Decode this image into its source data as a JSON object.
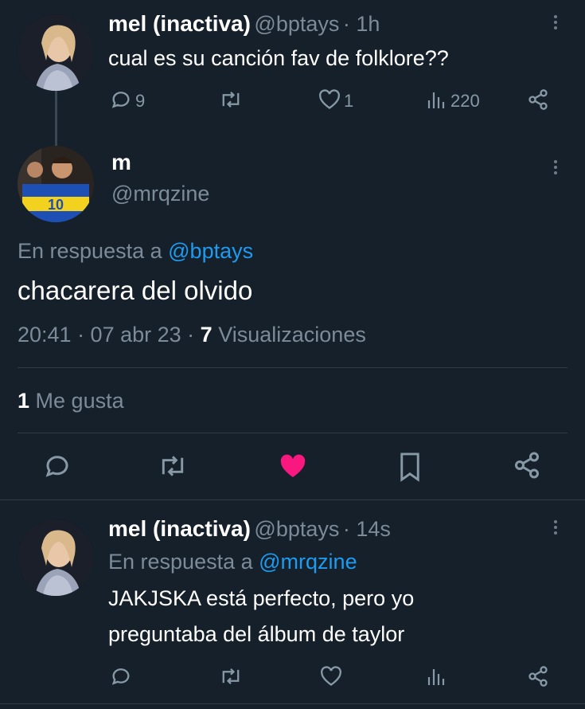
{
  "tweet1": {
    "name": "mel (inactiva)",
    "handle": "@bptays",
    "time": "· 1h",
    "text": "cual es su canción fav de folklore??",
    "replies": "9",
    "likes": "1",
    "views": "220"
  },
  "tweet2": {
    "name": "m",
    "handle": "@mrqzine",
    "reply_prefix": "En respuesta a",
    "reply_to": "@bptays",
    "text": "chacarera del olvido",
    "timestamp": "20:41 · 07 abr 23 ·",
    "view_count": "7",
    "view_label": "Visualizaciones",
    "like_count": "1",
    "like_label": "Me gusta"
  },
  "tweet3": {
    "name": "mel (inactiva)",
    "handle": "@bptays",
    "time": "· 14s",
    "reply_prefix": "En respuesta a",
    "reply_to": "@mrqzine",
    "text_line1": "JAKJSKA está perfecto, pero yo",
    "text_line2": "preguntaba del álbum de taylor"
  },
  "colors": {
    "background": "#15202b",
    "accent": "#1d9bf0",
    "like": "#f91880",
    "muted": "#7d8b99"
  },
  "icons": [
    "more-icon",
    "reply-icon",
    "retweet-icon",
    "like-icon",
    "views-icon",
    "share-icon",
    "bookmark-icon"
  ]
}
